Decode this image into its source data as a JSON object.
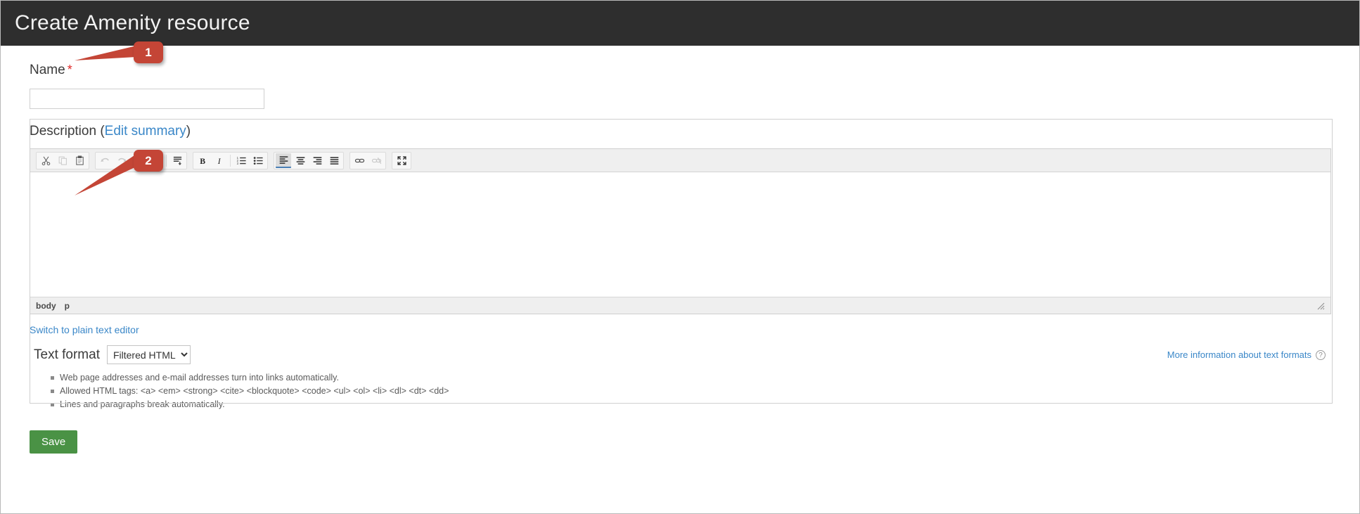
{
  "window": {
    "title": "Create Amenity resource"
  },
  "form": {
    "name": {
      "label": "Name",
      "required_mark": "*",
      "value": "",
      "placeholder": ""
    },
    "description": {
      "label": "Description",
      "open_paren": "(",
      "edit_summary_link": "Edit summary",
      "close_paren": ")",
      "body_text": ""
    },
    "switch_editor_link": "Switch to plain text editor",
    "text_format": {
      "label": "Text format",
      "selected": "Filtered HTML",
      "options": [
        "Filtered HTML"
      ],
      "more_info_link": "More information about text formats",
      "help_icon": "question-mark-icon",
      "help_items": [
        "Web page addresses and e-mail addresses turn into links automatically.",
        "Allowed HTML tags: <a> <em> <strong> <cite> <blockquote> <code> <ul> <ol> <li> <dl> <dt> <dd>",
        "Lines and paragraphs break automatically."
      ]
    },
    "save_button": "Save"
  },
  "editor": {
    "elements_path": [
      "body",
      "p"
    ],
    "toolbar_groups": [
      {
        "name": "clipboard",
        "buttons": [
          {
            "name": "cut-icon",
            "title": "Cut",
            "state": "enabled"
          },
          {
            "name": "copy-icon",
            "title": "Copy",
            "state": "disabled"
          },
          {
            "name": "paste-icon",
            "title": "Paste",
            "state": "enabled"
          }
        ]
      },
      {
        "name": "editing",
        "buttons": [
          {
            "name": "undo-icon",
            "title": "Undo",
            "state": "disabled"
          },
          {
            "name": "redo-icon",
            "title": "Redo",
            "state": "disabled"
          },
          {
            "name": "find-icon",
            "title": "Find",
            "state": "enabled"
          },
          {
            "name": "replace-icon",
            "title": "Replace",
            "state": "enabled"
          },
          {
            "name": "remove-format-icon",
            "title": "Remove Format",
            "state": "enabled"
          }
        ]
      },
      {
        "name": "basic-styles-and-lists",
        "buttons": [
          {
            "name": "bold-icon",
            "title": "Bold",
            "state": "enabled"
          },
          {
            "name": "italic-icon",
            "title": "Italic",
            "state": "enabled"
          },
          {
            "name": "numbered-list-icon",
            "title": "Insert/Remove Numbered List",
            "state": "enabled"
          },
          {
            "name": "bulleted-list-icon",
            "title": "Insert/Remove Bulleted List",
            "state": "enabled"
          }
        ]
      },
      {
        "name": "alignment",
        "buttons": [
          {
            "name": "align-left-icon",
            "title": "Align Left",
            "state": "active"
          },
          {
            "name": "align-center-icon",
            "title": "Center",
            "state": "enabled"
          },
          {
            "name": "align-right-icon",
            "title": "Align Right",
            "state": "enabled"
          },
          {
            "name": "align-justify-icon",
            "title": "Justify",
            "state": "enabled"
          }
        ]
      },
      {
        "name": "links",
        "buttons": [
          {
            "name": "link-icon",
            "title": "Link",
            "state": "enabled"
          },
          {
            "name": "unlink-icon",
            "title": "Unlink",
            "state": "disabled"
          }
        ]
      },
      {
        "name": "tools",
        "buttons": [
          {
            "name": "maximize-icon",
            "title": "Maximize",
            "state": "enabled"
          }
        ]
      }
    ]
  },
  "annotations": [
    {
      "label": "1",
      "target": "name-field"
    },
    {
      "label": "2",
      "target": "description-editor"
    }
  ],
  "colors": {
    "header_background": "#2e2e2e",
    "header_text": "#f2f2f2",
    "link": "#3a87c8",
    "required": "#e02a2a",
    "save_button": "#4a9245",
    "annotation": "#c44536",
    "toolbar_background": "#efefef",
    "active_toolbar_underline": "#4a7fb5"
  }
}
